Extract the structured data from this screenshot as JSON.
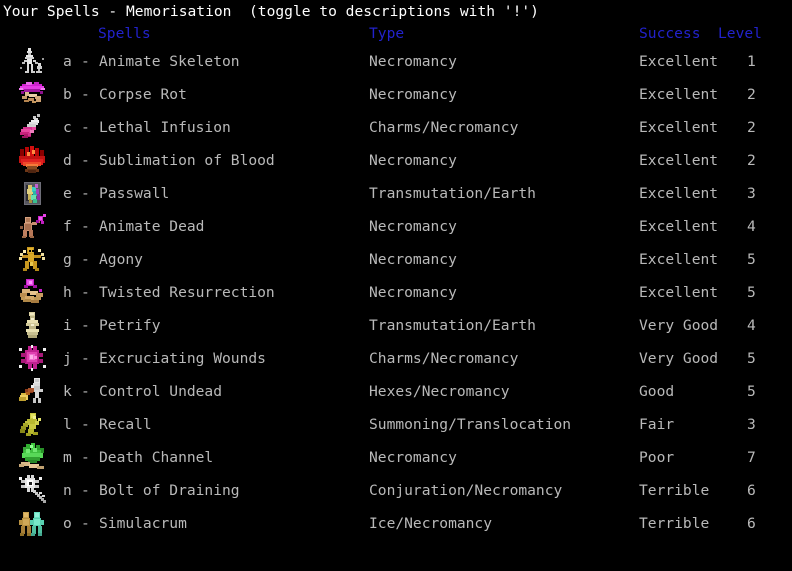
{
  "window": {
    "title": "Your Spells - Memorisation  (toggle to descriptions with '!')",
    "background_color": "#000000",
    "text_color": "#b9b9b9",
    "title_color": "#ffffff",
    "header_color": "#2222cc"
  },
  "table": {
    "headers": {
      "spells": "Spells",
      "type": "Type",
      "success": "Success",
      "level": "Level"
    },
    "separator": "-",
    "rows": [
      {
        "letter": "a",
        "name": "Animate Skeleton",
        "type": "Necromancy",
        "success": "Excellent",
        "level": "1",
        "icon": "animate-skeleton-icon"
      },
      {
        "letter": "b",
        "name": "Corpse Rot",
        "type": "Necromancy",
        "success": "Excellent",
        "level": "2",
        "icon": "corpse-rot-icon"
      },
      {
        "letter": "c",
        "name": "Lethal Infusion",
        "type": "Charms/Necromancy",
        "success": "Excellent",
        "level": "2",
        "icon": "lethal-infusion-icon"
      },
      {
        "letter": "d",
        "name": "Sublimation of Blood",
        "type": "Necromancy",
        "success": "Excellent",
        "level": "2",
        "icon": "sublimation-of-blood-icon"
      },
      {
        "letter": "e",
        "name": "Passwall",
        "type": "Transmutation/Earth",
        "success": "Excellent",
        "level": "3",
        "icon": "passwall-icon"
      },
      {
        "letter": "f",
        "name": "Animate Dead",
        "type": "Necromancy",
        "success": "Excellent",
        "level": "4",
        "icon": "animate-dead-icon"
      },
      {
        "letter": "g",
        "name": "Agony",
        "type": "Necromancy",
        "success": "Excellent",
        "level": "5",
        "icon": "agony-icon"
      },
      {
        "letter": "h",
        "name": "Twisted Resurrection",
        "type": "Necromancy",
        "success": "Excellent",
        "level": "5",
        "icon": "twisted-resurrection-icon"
      },
      {
        "letter": "i",
        "name": "Petrify",
        "type": "Transmutation/Earth",
        "success": "Very Good",
        "level": "4",
        "icon": "petrify-icon"
      },
      {
        "letter": "j",
        "name": "Excruciating Wounds",
        "type": "Charms/Necromancy",
        "success": "Very Good",
        "level": "5",
        "icon": "excruciating-wounds-icon"
      },
      {
        "letter": "k",
        "name": "Control Undead",
        "type": "Hexes/Necromancy",
        "success": "Good",
        "level": "5",
        "icon": "control-undead-icon"
      },
      {
        "letter": "l",
        "name": "Recall",
        "type": "Summoning/Translocation",
        "success": "Fair",
        "level": "3",
        "icon": "recall-icon"
      },
      {
        "letter": "m",
        "name": "Death Channel",
        "type": "Necromancy",
        "success": "Poor",
        "level": "7",
        "icon": "death-channel-icon"
      },
      {
        "letter": "n",
        "name": "Bolt of Draining",
        "type": "Conjuration/Necromancy",
        "success": "Terrible",
        "level": "6",
        "icon": "bolt-of-draining-icon"
      },
      {
        "letter": "o",
        "name": "Simulacrum",
        "type": "Ice/Necromancy",
        "success": "Terrible",
        "level": "6",
        "icon": "simulacrum-icon"
      }
    ]
  }
}
